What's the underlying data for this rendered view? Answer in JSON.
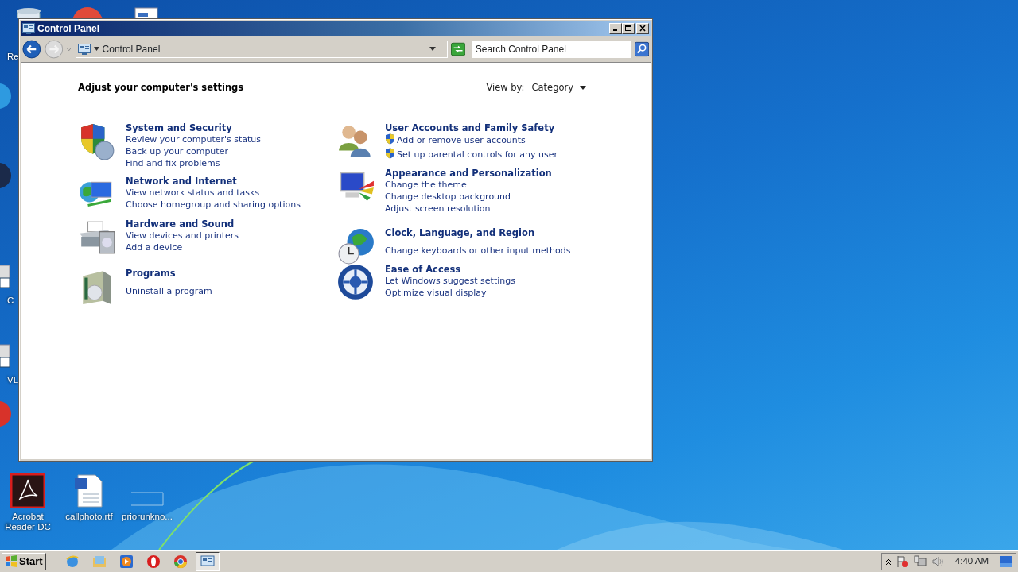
{
  "desktop_icons": [
    {
      "kind": "recycle",
      "label": "Re"
    },
    {
      "kind": "chrome"
    },
    {
      "kind": "document"
    },
    {
      "kind": "blue"
    },
    {
      "kind": "dark"
    },
    {
      "kind": "shortcut",
      "label": "C"
    },
    {
      "kind": "shortcut",
      "label": "VL"
    },
    {
      "kind": "red"
    },
    {
      "kind": "acrobat",
      "label": "Acrobat Reader DC"
    },
    {
      "kind": "word",
      "label": "callphoto.rtf"
    },
    {
      "kind": "blank",
      "label": "priorunkno..."
    }
  ],
  "window": {
    "title": "Control Panel",
    "address": "Control Panel",
    "search": {
      "placeholder": "Search Control Panel"
    },
    "heading": "Adjust your computer's settings",
    "view_by": {
      "label": "View by:",
      "value": "Category"
    }
  },
  "columns": [
    [
      {
        "kind": "security",
        "title": "System and Security",
        "links": [
          {
            "text": "Review your computer's status",
            "shield": false
          },
          {
            "text": "Back up your computer",
            "shield": false
          },
          {
            "text": "Find and fix problems",
            "shield": false
          }
        ]
      },
      {
        "kind": "network",
        "title": "Network and Internet",
        "links": [
          {
            "text": "View network status and tasks",
            "shield": false
          },
          {
            "text": "Choose homegroup and sharing options",
            "shield": false
          }
        ]
      },
      {
        "kind": "hardware",
        "title": "Hardware and Sound",
        "links": [
          {
            "text": "View devices and printers",
            "shield": false
          },
          {
            "text": "Add a device",
            "shield": false
          }
        ]
      },
      {
        "kind": "programs",
        "title": "Programs",
        "links": [
          {
            "text": "Uninstall a program",
            "shield": false
          }
        ]
      }
    ],
    [
      {
        "kind": "users",
        "title": "User Accounts and Family Safety",
        "links": [
          {
            "text": "Add or remove user accounts",
            "shield": true
          },
          {
            "text": "Set up parental controls for any user",
            "shield": true
          }
        ]
      },
      {
        "kind": "appearance",
        "title": "Appearance and Personalization",
        "links": [
          {
            "text": "Change the theme",
            "shield": false
          },
          {
            "text": "Change desktop background",
            "shield": false
          },
          {
            "text": "Adjust screen resolution",
            "shield": false
          }
        ]
      },
      {
        "kind": "clock",
        "title": "Clock, Language, and Region",
        "links": [
          {
            "text": "Change keyboards or other input methods",
            "shield": false
          }
        ]
      },
      {
        "kind": "ease",
        "title": "Ease of Access",
        "links": [
          {
            "text": "Let Windows suggest settings",
            "shield": false
          },
          {
            "text": "Optimize visual display",
            "shield": false
          }
        ]
      }
    ]
  ],
  "taskbar": {
    "start": "Start",
    "apps": [
      {
        "kind": "ie",
        "selected": false
      },
      {
        "kind": "explorer",
        "selected": false
      },
      {
        "kind": "media",
        "selected": false
      },
      {
        "kind": "opera",
        "selected": false
      },
      {
        "kind": "chrome",
        "selected": false
      },
      {
        "kind": "controlpanel",
        "selected": true
      }
    ],
    "clock": "4:40 AM"
  }
}
